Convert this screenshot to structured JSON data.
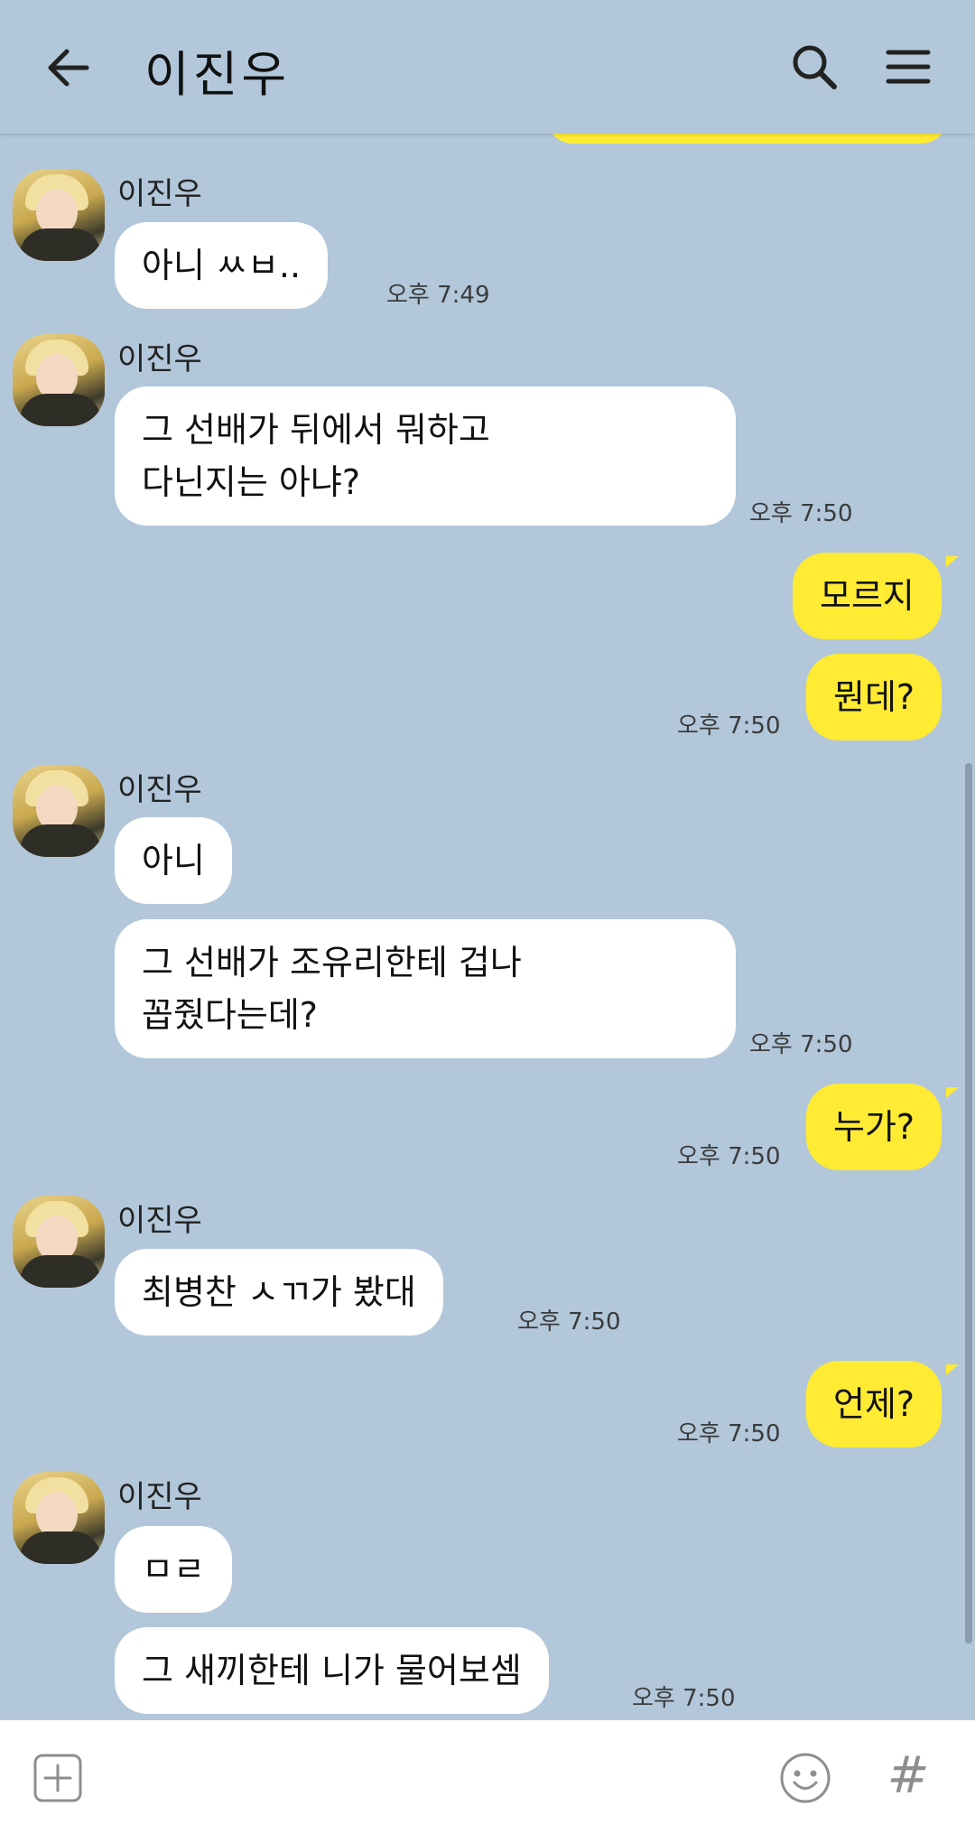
{
  "header": {
    "title": "이진우",
    "back_icon": "arrow-left-icon",
    "search_icon": "search-icon",
    "menu_icon": "menu-icon"
  },
  "peek": {
    "time": "오후 7:49"
  },
  "messages": [
    {
      "sender": "이진우",
      "text": "아니 ㅆㅂ..",
      "time": "오후 7:49"
    },
    {
      "sender": "이진우",
      "line1": "그 선배가 뒤에서 뭐하고",
      "line2": "다닌지는 아냐?",
      "time": "오후 7:50"
    },
    {
      "text": "모르지"
    },
    {
      "text": "뭔데?",
      "time": "오후 7:50"
    },
    {
      "sender": "이진우",
      "text": "아니"
    },
    {
      "line1": "그 선배가 조유리한테 겁나",
      "line2": "꼽줬다는데?",
      "time": "오후 7:50"
    },
    {
      "text": "누가?",
      "time": "오후 7:50"
    },
    {
      "sender": "이진우",
      "text": "최병찬 ㅅㄲ가 봤대",
      "time": "오후 7:50"
    },
    {
      "text": "언제?",
      "time": "오후 7:50"
    },
    {
      "sender": "이진우",
      "text": "ㅁㄹ"
    },
    {
      "text": "그 새끼한테 니가 물어보셈",
      "time": "오후 7:50"
    }
  ],
  "composer": {
    "placeholder": "",
    "plus_icon": "plus-square-icon",
    "emoji_icon": "smiley-icon",
    "hash_icon": "hash-icon",
    "hash_label": "#"
  },
  "colors": {
    "background": "#b2c7da",
    "incoming_bubble": "#ffffff",
    "outgoing_bubble": "#ffeb33"
  }
}
